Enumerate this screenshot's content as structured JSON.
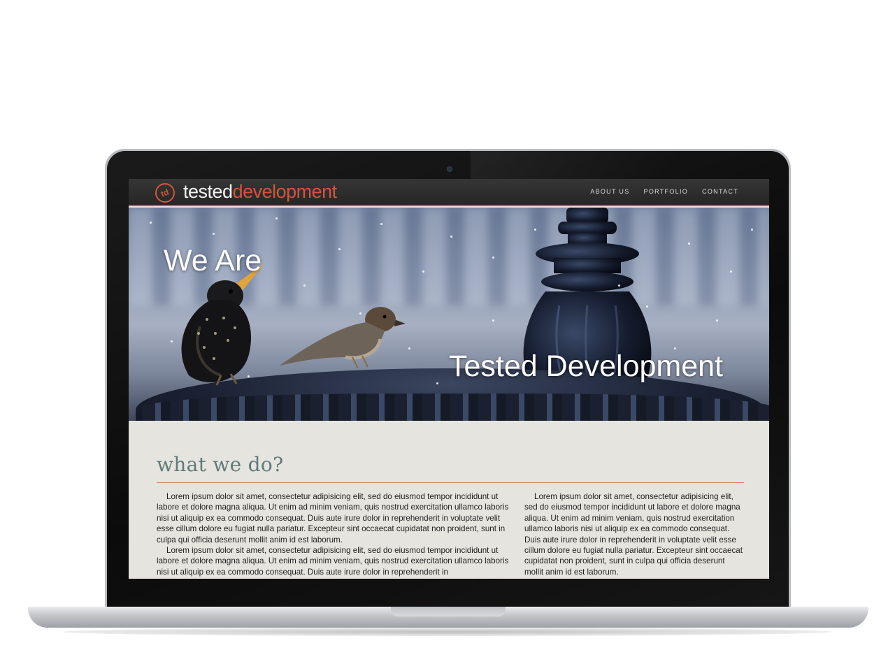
{
  "site": {
    "logo_part1": "tested",
    "logo_part2": "development",
    "logo_mark": "td",
    "accent_color": "#d2553c"
  },
  "nav": {
    "items": [
      {
        "label": "ABOUT US"
      },
      {
        "label": "PORTFOLIO"
      },
      {
        "label": "CONTACT"
      }
    ]
  },
  "hero": {
    "line1": "We Are",
    "line2": "Tested Development"
  },
  "section": {
    "title": "what we do?",
    "left_column": [
      "Lorem ipsum dolor sit amet, consectetur adipisicing elit, sed do eiusmod tempor incididunt ut labore et dolore magna aliqua. Ut enim ad minim veniam, quis nostrud exercitation ullamco laboris nisi ut aliquip ex ea commodo consequat. Duis aute irure dolor in reprehenderit in voluptate velit esse cillum dolore eu fugiat nulla pariatur. Excepteur sint occaecat cupidatat non proident, sunt in culpa qui officia deserunt mollit anim id est laborum.",
      "Lorem ipsum dolor sit amet, consectetur adipisicing elit, sed do eiusmod tempor incididunt ut labore et dolore magna aliqua. Ut enim ad minim veniam, quis nostrud exercitation ullamco laboris nisi ut aliquip ex ea commodo consequat. Duis aute irure dolor in reprehenderit in"
    ],
    "right_column": [
      "Lorem ipsum dolor sit amet, consectetur adipisicing elit, sed do eiusmod tempor incididunt ut labore et dolore magna aliqua. Ut enim ad minim veniam, quis nostrud exercitation ullamco laboris nisi ut aliquip ex ea commodo consequat. Duis aute irure dolor in reprehenderit in voluptate velit esse cillum dolore eu fugiat nulla pariatur. Excepteur sint occaecat cupidatat non proident, sunt in culpa qui officia deserunt mollit anim id est laborum."
    ]
  }
}
